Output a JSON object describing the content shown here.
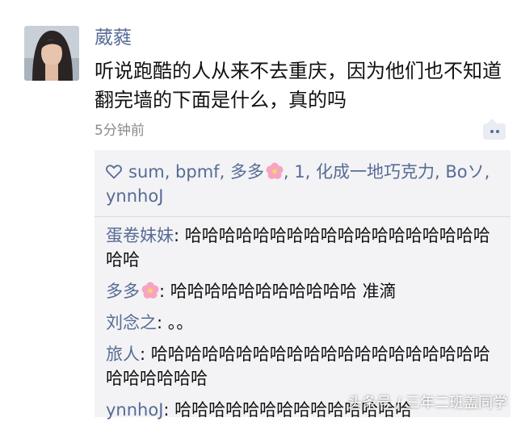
{
  "post": {
    "username": "葳蕤",
    "text": "听说跑酷的人从来不去重庆，因为他们也不知道翻完墙的下面是什么，真的吗",
    "time": "5分钟前"
  },
  "likes": {
    "part1": "sum, bpmf, 多多",
    "part2": ", 1, 化成一地巧克力, Boソ, ynnhoJ"
  },
  "comments": [
    {
      "name": "蛋卷妹妹",
      "sep": ": ",
      "text": "哈哈哈哈哈哈哈哈哈哈哈哈哈哈哈哈哈哈哈哈"
    },
    {
      "name": "多多",
      "sep": ": ",
      "text": "哈哈哈哈哈哈哈哈哈哈哈 准滴",
      "flower": true
    },
    {
      "name": "刘念之",
      "sep": ": ",
      "text": "。。"
    },
    {
      "name": "旅人",
      "sep": ": ",
      "text": "哈哈哈哈哈哈哈哈哈哈哈哈哈哈哈哈哈哈哈哈哈哈哈哈哈哈"
    },
    {
      "name": "ynnhoJ",
      "sep": ": ",
      "text": "哈哈哈哈哈哈哈哈哈哈哈哈哈哈"
    }
  ],
  "watermark": "头条号 / 三年二班盖同学",
  "colors": {
    "link": "#576b95",
    "panel": "#f3f3f5",
    "meta": "#8a8a8a"
  }
}
